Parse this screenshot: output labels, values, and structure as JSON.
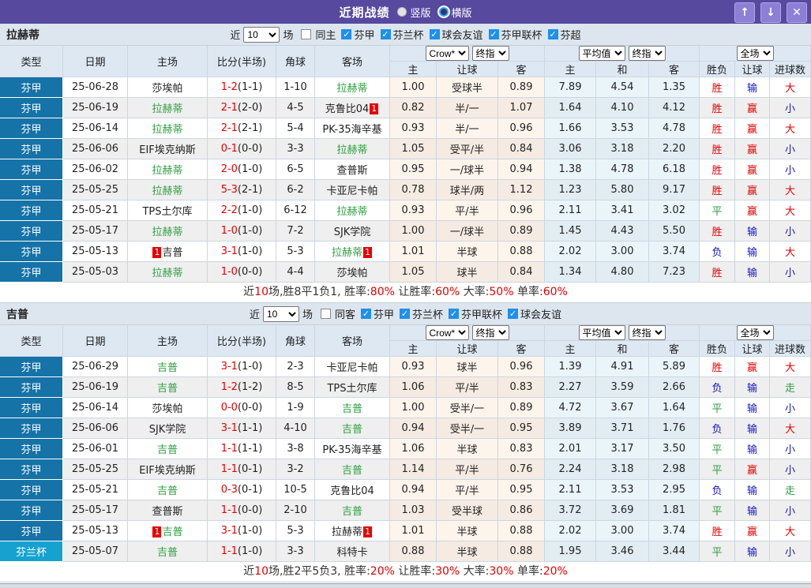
{
  "titlebar": {
    "title": "近期战绩",
    "layout_options": [
      {
        "label": "竖版",
        "selected": true
      },
      {
        "label": "横版",
        "selected": false
      }
    ],
    "buttons": {
      "up": "↑",
      "down": "↓",
      "close": "✕"
    }
  },
  "table_header": {
    "main_cols": [
      "类型",
      "日期",
      "主场",
      "比分(半场)",
      "角球",
      "客场"
    ],
    "sub_cols": [
      "主",
      "让球",
      "客",
      "主",
      "和",
      "客",
      "胜负",
      "让球",
      "进球数"
    ],
    "dropdowns": {
      "odds_source": "Crow*",
      "odds_final": "终指",
      "avg_source": "平均值",
      "avg_final": "终指",
      "scope": "全场"
    }
  },
  "colors": {
    "accent_purple": "#57499e",
    "type_league_blue": "#1573a8",
    "type_cup_cyan": "#16a2cf",
    "team_green": "#2d9f3f",
    "win_red": "#e60000",
    "loss_blue": "#1515c8",
    "checkbox_blue": "#1e90ec"
  },
  "sections": [
    {
      "team": "拉赫蒂",
      "filter": {
        "prefix": "近",
        "count": "10",
        "suffix": "场",
        "same_venue_label": "同主",
        "same_venue_checked": false,
        "leagues": [
          {
            "label": "芬甲",
            "checked": true
          },
          {
            "label": "芬兰杯",
            "checked": true
          },
          {
            "label": "球会友谊",
            "checked": true
          },
          {
            "label": "芬甲联杯",
            "checked": true
          },
          {
            "label": "芬超",
            "checked": true
          }
        ]
      },
      "rows": [
        {
          "league": "芬甲",
          "cup": false,
          "date": "25-06-28",
          "home": "莎埃帕",
          "home_green": false,
          "home_badge": null,
          "score": "1-2",
          "half": "(1-1)",
          "corner": "1-10",
          "away": "拉赫蒂",
          "away_green": true,
          "away_badge": null,
          "odds": [
            "1.00",
            "受球半",
            "0.89"
          ],
          "avg": [
            "7.89",
            "4.54",
            "1.35"
          ],
          "results": [
            "胜",
            "输",
            "大"
          ]
        },
        {
          "league": "芬甲",
          "cup": false,
          "date": "25-06-19",
          "home": "拉赫蒂",
          "home_green": true,
          "home_badge": null,
          "score": "2-1",
          "half": "(2-0)",
          "corner": "4-5",
          "away": "克鲁比04",
          "away_green": false,
          "away_badge": {
            "text": "1",
            "pos": "after"
          },
          "odds": [
            "0.82",
            "半/一",
            "1.07"
          ],
          "avg": [
            "1.64",
            "4.10",
            "4.12"
          ],
          "results": [
            "胜",
            "赢",
            "小"
          ]
        },
        {
          "league": "芬甲",
          "cup": false,
          "date": "25-06-14",
          "home": "拉赫蒂",
          "home_green": true,
          "home_badge": null,
          "score": "2-1",
          "half": "(2-1)",
          "corner": "5-4",
          "away": "PK-35海辛基",
          "away_green": false,
          "away_badge": null,
          "odds": [
            "0.93",
            "半/一",
            "0.96"
          ],
          "avg": [
            "1.66",
            "3.53",
            "4.78"
          ],
          "results": [
            "胜",
            "赢",
            "大"
          ]
        },
        {
          "league": "芬甲",
          "cup": false,
          "date": "25-06-06",
          "home": "EIF埃克纳斯",
          "home_green": false,
          "home_badge": null,
          "score": "0-1",
          "half": "(0-0)",
          "corner": "3-3",
          "away": "拉赫蒂",
          "away_green": true,
          "away_badge": null,
          "odds": [
            "1.05",
            "受平/半",
            "0.84"
          ],
          "avg": [
            "3.06",
            "3.18",
            "2.20"
          ],
          "results": [
            "胜",
            "赢",
            "小"
          ]
        },
        {
          "league": "芬甲",
          "cup": false,
          "date": "25-06-02",
          "home": "拉赫蒂",
          "home_green": true,
          "home_badge": null,
          "score": "2-0",
          "half": "(1-0)",
          "corner": "6-5",
          "away": "查普斯",
          "away_green": false,
          "away_badge": null,
          "odds": [
            "0.95",
            "一/球半",
            "0.94"
          ],
          "avg": [
            "1.38",
            "4.78",
            "6.18"
          ],
          "results": [
            "胜",
            "赢",
            "小"
          ]
        },
        {
          "league": "芬甲",
          "cup": false,
          "date": "25-05-25",
          "home": "拉赫蒂",
          "home_green": true,
          "home_badge": null,
          "score": "5-3",
          "half": "(2-1)",
          "corner": "6-2",
          "away": "卡亚尼卡帕",
          "away_green": false,
          "away_badge": null,
          "odds": [
            "0.78",
            "球半/两",
            "1.12"
          ],
          "avg": [
            "1.23",
            "5.80",
            "9.17"
          ],
          "results": [
            "胜",
            "赢",
            "大"
          ]
        },
        {
          "league": "芬甲",
          "cup": false,
          "date": "25-05-21",
          "home": "TPS土尔库",
          "home_green": false,
          "home_badge": null,
          "score": "2-2",
          "half": "(1-0)",
          "corner": "6-12",
          "away": "拉赫蒂",
          "away_green": true,
          "away_badge": null,
          "odds": [
            "0.93",
            "平/半",
            "0.96"
          ],
          "avg": [
            "2.11",
            "3.41",
            "3.02"
          ],
          "results": [
            "平",
            "赢",
            "大"
          ]
        },
        {
          "league": "芬甲",
          "cup": false,
          "date": "25-05-17",
          "home": "拉赫蒂",
          "home_green": true,
          "home_badge": null,
          "score": "1-0",
          "half": "(1-0)",
          "corner": "7-2",
          "away": "SJK学院",
          "away_green": false,
          "away_badge": null,
          "odds": [
            "1.00",
            "一/球半",
            "0.89"
          ],
          "avg": [
            "1.45",
            "4.43",
            "5.50"
          ],
          "results": [
            "胜",
            "输",
            "小"
          ]
        },
        {
          "league": "芬甲",
          "cup": false,
          "date": "25-05-13",
          "home": "吉普",
          "home_green": false,
          "home_badge": {
            "text": "1",
            "pos": "before"
          },
          "score": "3-1",
          "half": "(1-0)",
          "corner": "5-3",
          "away": "拉赫蒂",
          "away_green": true,
          "away_badge": {
            "text": "1",
            "pos": "after"
          },
          "odds": [
            "1.01",
            "半球",
            "0.88"
          ],
          "avg": [
            "2.02",
            "3.00",
            "3.74"
          ],
          "results": [
            "负",
            "输",
            "大"
          ]
        },
        {
          "league": "芬甲",
          "cup": false,
          "date": "25-05-03",
          "home": "拉赫蒂",
          "home_green": true,
          "home_badge": null,
          "score": "1-0",
          "half": "(0-0)",
          "corner": "4-4",
          "away": "莎埃帕",
          "away_green": false,
          "away_badge": null,
          "odds": [
            "1.05",
            "球半",
            "0.84"
          ],
          "avg": [
            "1.34",
            "4.80",
            "7.23"
          ],
          "results": [
            "胜",
            "输",
            "小"
          ]
        }
      ],
      "summary": [
        {
          "text": "近"
        },
        {
          "text": "10",
          "red": true
        },
        {
          "text": "场,胜8平1负1, 胜率:"
        },
        {
          "text": "80%",
          "red": true
        },
        {
          "text": " 让胜率:"
        },
        {
          "text": "60%",
          "red": true
        },
        {
          "text": " 大率:"
        },
        {
          "text": "50%",
          "red": true
        },
        {
          "text": " 单率:"
        },
        {
          "text": "60%",
          "red": true
        }
      ]
    },
    {
      "team": "吉普",
      "filter": {
        "prefix": "近",
        "count": "10",
        "suffix": "场",
        "same_venue_label": "同客",
        "same_venue_checked": false,
        "leagues": [
          {
            "label": "芬甲",
            "checked": true
          },
          {
            "label": "芬兰杯",
            "checked": true
          },
          {
            "label": "芬甲联杯",
            "checked": true
          },
          {
            "label": "球会友谊",
            "checked": true
          }
        ]
      },
      "rows": [
        {
          "league": "芬甲",
          "cup": false,
          "date": "25-06-29",
          "home": "吉普",
          "home_green": true,
          "home_badge": null,
          "score": "3-1",
          "half": "(1-0)",
          "corner": "2-3",
          "away": "卡亚尼卡帕",
          "away_green": false,
          "away_badge": null,
          "odds": [
            "0.93",
            "球半",
            "0.96"
          ],
          "avg": [
            "1.39",
            "4.91",
            "5.89"
          ],
          "results": [
            "胜",
            "赢",
            "大"
          ]
        },
        {
          "league": "芬甲",
          "cup": false,
          "date": "25-06-19",
          "home": "吉普",
          "home_green": true,
          "home_badge": null,
          "score": "1-2",
          "half": "(1-2)",
          "corner": "8-5",
          "away": "TPS土尔库",
          "away_green": false,
          "away_badge": null,
          "odds": [
            "1.06",
            "平/半",
            "0.83"
          ],
          "avg": [
            "2.27",
            "3.59",
            "2.66"
          ],
          "results": [
            "负",
            "输",
            "走"
          ]
        },
        {
          "league": "芬甲",
          "cup": false,
          "date": "25-06-14",
          "home": "莎埃帕",
          "home_green": false,
          "home_badge": null,
          "score": "0-0",
          "half": "(0-0)",
          "corner": "1-9",
          "away": "吉普",
          "away_green": true,
          "away_badge": null,
          "odds": [
            "1.00",
            "受半/一",
            "0.89"
          ],
          "avg": [
            "4.72",
            "3.67",
            "1.64"
          ],
          "results": [
            "平",
            "输",
            "小"
          ]
        },
        {
          "league": "芬甲",
          "cup": false,
          "date": "25-06-06",
          "home": "SJK学院",
          "home_green": false,
          "home_badge": null,
          "score": "3-1",
          "half": "(1-1)",
          "corner": "4-10",
          "away": "吉普",
          "away_green": true,
          "away_badge": null,
          "odds": [
            "0.94",
            "受半/一",
            "0.95"
          ],
          "avg": [
            "3.89",
            "3.71",
            "1.76"
          ],
          "results": [
            "负",
            "输",
            "大"
          ]
        },
        {
          "league": "芬甲",
          "cup": false,
          "date": "25-06-01",
          "home": "吉普",
          "home_green": true,
          "home_badge": null,
          "score": "1-1",
          "half": "(1-1)",
          "corner": "3-8",
          "away": "PK-35海辛基",
          "away_green": false,
          "away_badge": null,
          "odds": [
            "1.06",
            "半球",
            "0.83"
          ],
          "avg": [
            "2.01",
            "3.17",
            "3.50"
          ],
          "results": [
            "平",
            "输",
            "小"
          ]
        },
        {
          "league": "芬甲",
          "cup": false,
          "date": "25-05-25",
          "home": "EIF埃克纳斯",
          "home_green": false,
          "home_badge": null,
          "score": "1-1",
          "half": "(0-1)",
          "corner": "3-2",
          "away": "吉普",
          "away_green": true,
          "away_badge": null,
          "odds": [
            "1.14",
            "平/半",
            "0.76"
          ],
          "avg": [
            "2.24",
            "3.18",
            "2.98"
          ],
          "results": [
            "平",
            "赢",
            "小"
          ]
        },
        {
          "league": "芬甲",
          "cup": false,
          "date": "25-05-21",
          "home": "吉普",
          "home_green": true,
          "home_badge": null,
          "score": "0-3",
          "half": "(0-1)",
          "corner": "10-5",
          "away": "克鲁比04",
          "away_green": false,
          "away_badge": null,
          "odds": [
            "0.94",
            "平/半",
            "0.95"
          ],
          "avg": [
            "2.11",
            "3.53",
            "2.95"
          ],
          "results": [
            "负",
            "输",
            "走"
          ]
        },
        {
          "league": "芬甲",
          "cup": false,
          "date": "25-05-17",
          "home": "查普斯",
          "home_green": false,
          "home_badge": null,
          "score": "1-1",
          "half": "(0-0)",
          "corner": "2-10",
          "away": "吉普",
          "away_green": true,
          "away_badge": null,
          "odds": [
            "1.03",
            "受半球",
            "0.86"
          ],
          "avg": [
            "3.72",
            "3.69",
            "1.81"
          ],
          "results": [
            "平",
            "输",
            "小"
          ]
        },
        {
          "league": "芬甲",
          "cup": false,
          "date": "25-05-13",
          "home": "吉普",
          "home_green": true,
          "home_badge": {
            "text": "1",
            "pos": "before"
          },
          "score": "3-1",
          "half": "(1-0)",
          "corner": "5-3",
          "away": "拉赫蒂",
          "away_green": false,
          "away_badge": {
            "text": "1",
            "pos": "after"
          },
          "odds": [
            "1.01",
            "半球",
            "0.88"
          ],
          "avg": [
            "2.02",
            "3.00",
            "3.74"
          ],
          "results": [
            "胜",
            "赢",
            "大"
          ]
        },
        {
          "league": "芬兰杯",
          "cup": true,
          "date": "25-05-07",
          "home": "吉普",
          "home_green": true,
          "home_badge": null,
          "score": "1-1",
          "half": "(1-0)",
          "corner": "3-3",
          "away": "科特卡",
          "away_green": false,
          "away_badge": null,
          "odds": [
            "0.88",
            "半球",
            "0.88"
          ],
          "avg": [
            "1.95",
            "3.46",
            "3.44"
          ],
          "results": [
            "平",
            "输",
            "小"
          ]
        }
      ],
      "summary": [
        {
          "text": "近"
        },
        {
          "text": "10",
          "red": true
        },
        {
          "text": "场,胜2平5负3, 胜率:"
        },
        {
          "text": "20%",
          "red": true
        },
        {
          "text": " 让胜率:"
        },
        {
          "text": "30%",
          "red": true
        },
        {
          "text": " 大率:"
        },
        {
          "text": "30%",
          "red": true
        },
        {
          "text": " 单率:"
        },
        {
          "text": "20%",
          "red": true
        }
      ]
    }
  ]
}
